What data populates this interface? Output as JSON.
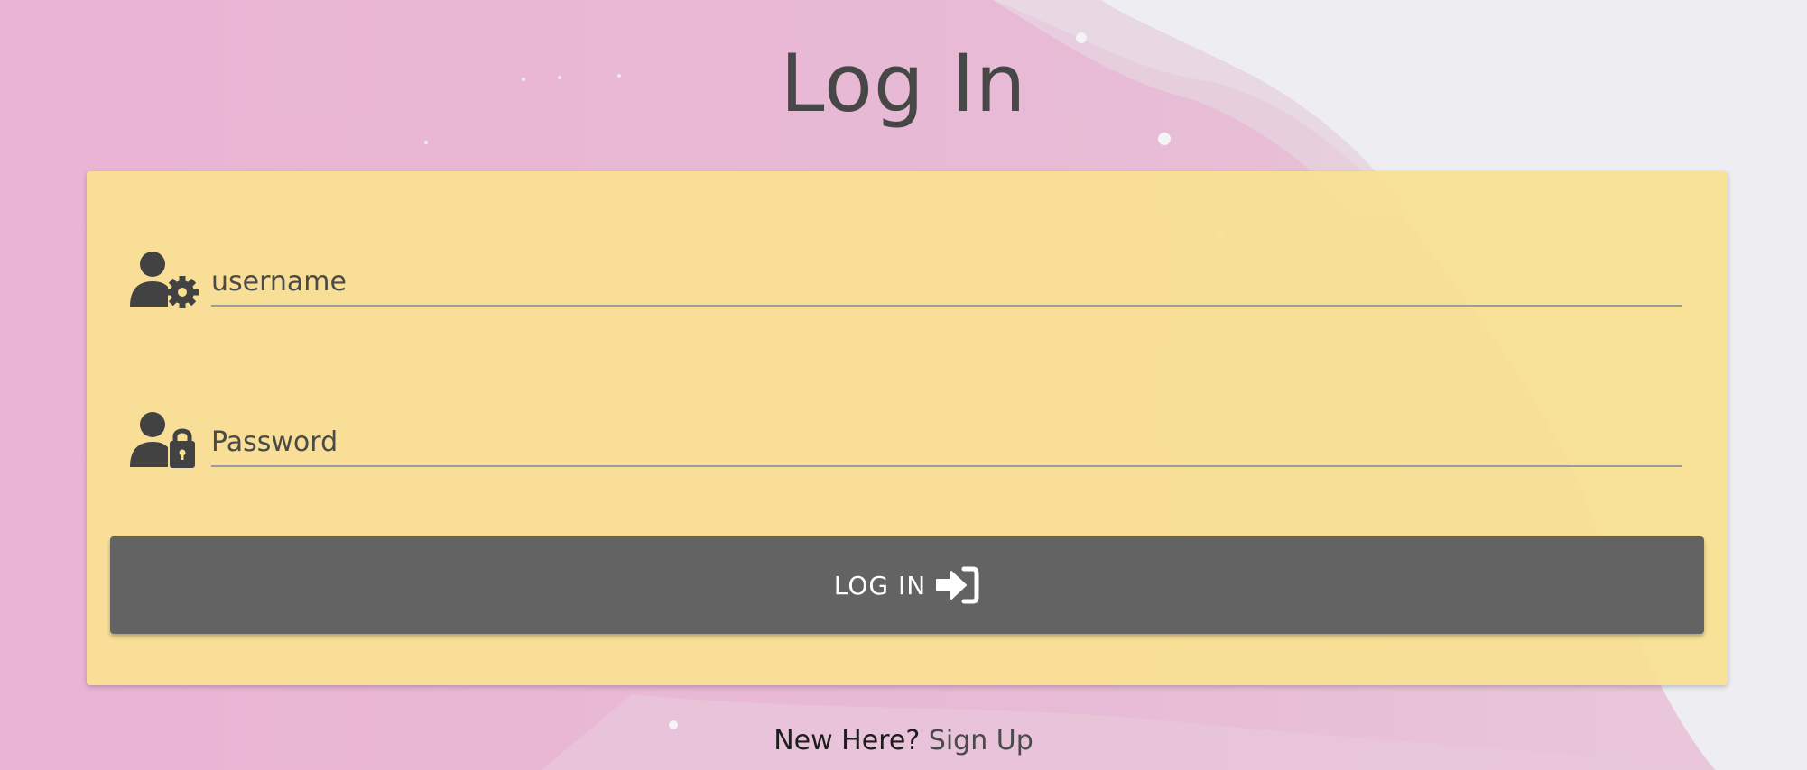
{
  "page": {
    "title": "Log In"
  },
  "form": {
    "username": {
      "placeholder": "username",
      "value": "",
      "icon": "user-gear-icon"
    },
    "password": {
      "placeholder": "Password",
      "value": "",
      "icon": "user-lock-icon"
    },
    "submit": {
      "label": "LOG IN",
      "icon": "sign-in-icon"
    }
  },
  "footer": {
    "prompt": "New Here?",
    "link_label": "Sign Up"
  },
  "colors": {
    "card": "#f9e191",
    "button": "#636363",
    "text": "#424242",
    "background_pink": "#ecb8d6",
    "background_gray": "#eeeef2"
  }
}
